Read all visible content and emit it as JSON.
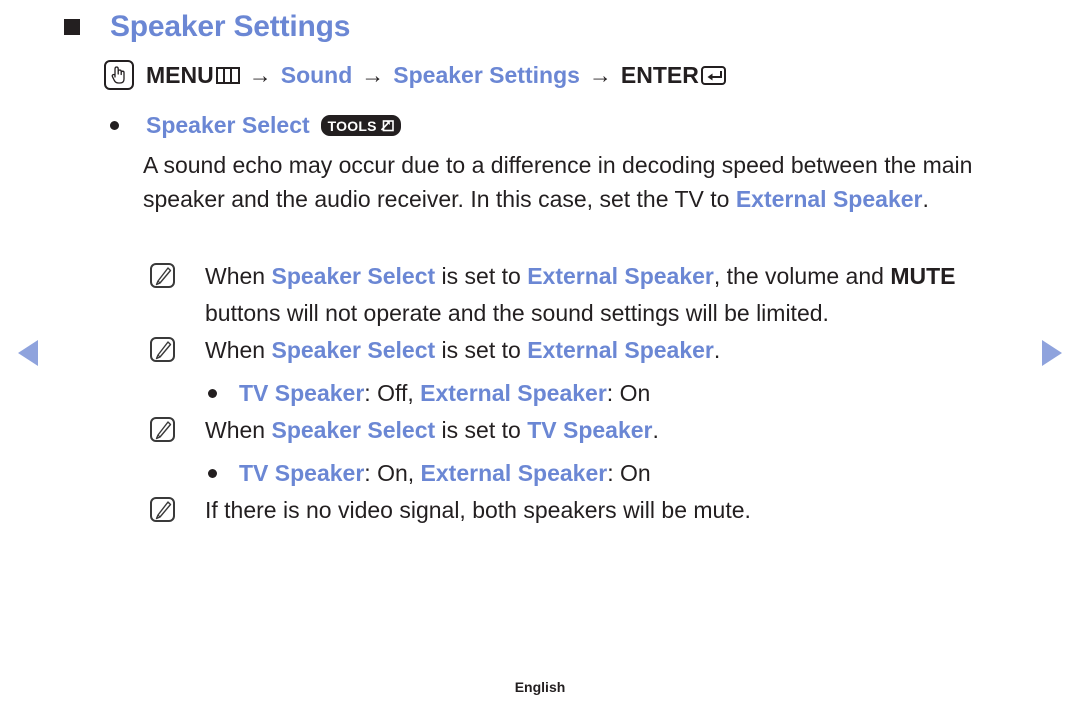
{
  "header": {
    "square_icon": "black-square-bullet",
    "title": "Speaker Settings"
  },
  "menu_path": {
    "hand_icon": "hand-pointer-icon",
    "menu_label": "MENU",
    "menu_icon": "menu-grid-icon",
    "arrow1": "→",
    "sound_label": "Sound",
    "arrow2": "→",
    "speaker_settings_label": "Speaker Settings",
    "arrow3": "→",
    "enter_label": "ENTER",
    "enter_icon": "enter-return-icon"
  },
  "bullet": {
    "dot_icon": "bullet-dot-icon",
    "label": "Speaker Select",
    "badge_text": "TOOLS",
    "badge_icon": "tools-arrow-icon"
  },
  "paragraph": {
    "part1": "A sound echo may occur due to a difference in decoding speed between the main speaker and the audio receiver. In this case, set the TV to ",
    "highlight": "External Speaker",
    "part2": "."
  },
  "notes": [
    {
      "icon": "note-pencil-icon",
      "segments": [
        {
          "text": "When ",
          "style": "plain"
        },
        {
          "text": "Speaker Select",
          "style": "blue-bold"
        },
        {
          "text": " is set to ",
          "style": "plain"
        },
        {
          "text": "External Speaker",
          "style": "blue-bold"
        },
        {
          "text": ", the volume and ",
          "style": "plain"
        },
        {
          "text": "MUTE",
          "style": "black-bold"
        },
        {
          "text": " buttons will not operate and the sound settings will be limited.",
          "style": "plain"
        }
      ]
    },
    {
      "icon": "note-pencil-icon",
      "segments": [
        {
          "text": "When ",
          "style": "plain"
        },
        {
          "text": "Speaker Select",
          "style": "blue-bold"
        },
        {
          "text": " is set to ",
          "style": "plain"
        },
        {
          "text": "External Speaker",
          "style": "blue-bold"
        },
        {
          "text": ".",
          "style": "plain"
        }
      ]
    },
    {
      "icon": "note-pencil-icon",
      "segments": [
        {
          "text": "When ",
          "style": "plain"
        },
        {
          "text": "Speaker Select",
          "style": "blue-bold"
        },
        {
          "text": " is set to ",
          "style": "plain"
        },
        {
          "text": "TV Speaker",
          "style": "blue-bold"
        },
        {
          "text": ".",
          "style": "plain"
        }
      ]
    },
    {
      "icon": "note-pencil-icon",
      "segments": [
        {
          "text": "If there is no video signal, both speakers will be mute.",
          "style": "plain"
        }
      ]
    }
  ],
  "sub_bullets": [
    {
      "dot_icon": "bullet-dot-icon",
      "segments": [
        {
          "text": "TV Speaker",
          "style": "blue-bold"
        },
        {
          "text": ": Off, ",
          "style": "plain"
        },
        {
          "text": "External Speaker",
          "style": "blue-bold"
        },
        {
          "text": ": On",
          "style": "plain"
        }
      ]
    },
    {
      "dot_icon": "bullet-dot-icon",
      "segments": [
        {
          "text": "TV Speaker",
          "style": "blue-bold"
        },
        {
          "text": ": On, ",
          "style": "plain"
        },
        {
          "text": "External Speaker",
          "style": "blue-bold"
        },
        {
          "text": ": On",
          "style": "plain"
        }
      ]
    }
  ],
  "nav": {
    "prev_icon": "prev-page-arrow-icon",
    "next_icon": "next-page-arrow-icon"
  },
  "footer": {
    "language": "English"
  },
  "colors": {
    "accent_blue": "#6b87d4",
    "nav_arrow_blue": "#8fa3dd",
    "text_black": "#231f20"
  }
}
